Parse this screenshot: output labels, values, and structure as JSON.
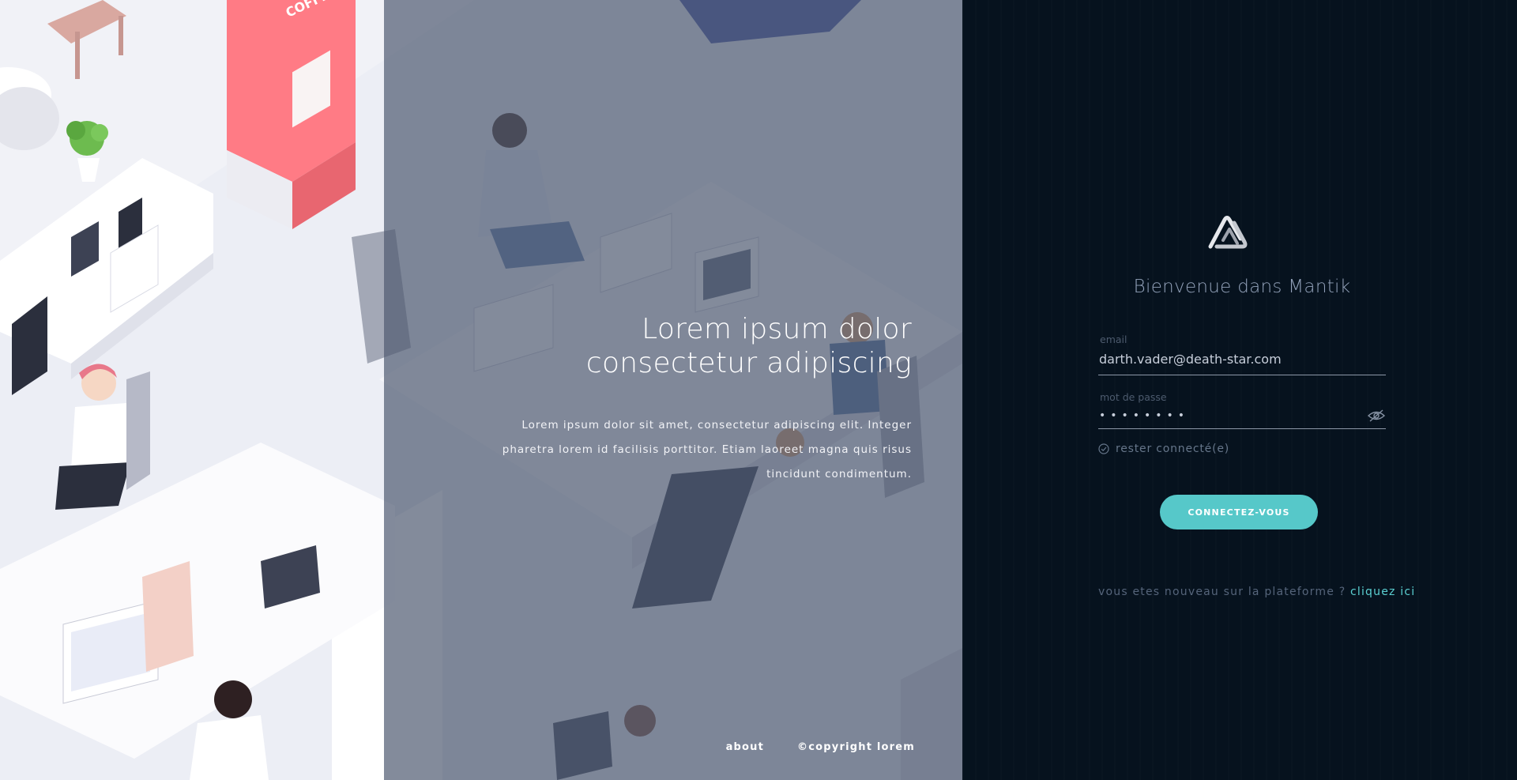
{
  "hero": {
    "title_line1": "Lorem ipsum dolor",
    "title_line2": "consectetur adipiscing",
    "text": "Lorem ipsum dolor sit amet, consectetur adipiscing elit. Integer pharetra lorem id facilisis porttitor. Etiam laoreet magna quis risus tincidunt condimentum."
  },
  "illustration": {
    "coffee_sign": "COFFEE"
  },
  "footer": {
    "about": "about",
    "copyright": "©copyright lorem"
  },
  "login": {
    "logo_icon": "mantik-logo-icon",
    "welcome": "Bienvenue dans Mantik",
    "email_label": "email",
    "email_value": "darth.vader@death-star.com",
    "password_label": "mot de passe",
    "password_value": "••••••••",
    "toggle_icon": "eye-slash-icon",
    "remember_icon": "check-circle-icon",
    "remember_label": "rester connecté(e)",
    "submit_label": "CONNECTEZ-VOUS",
    "signup_text": "vous etes nouveau sur la plateforme ? ",
    "signup_link": "cliquez ici"
  },
  "colors": {
    "panel_bg": "#06121e",
    "accent": "#56c8c9",
    "overlay": "#4e5a70",
    "coffee_machine": "#ff7b85"
  }
}
